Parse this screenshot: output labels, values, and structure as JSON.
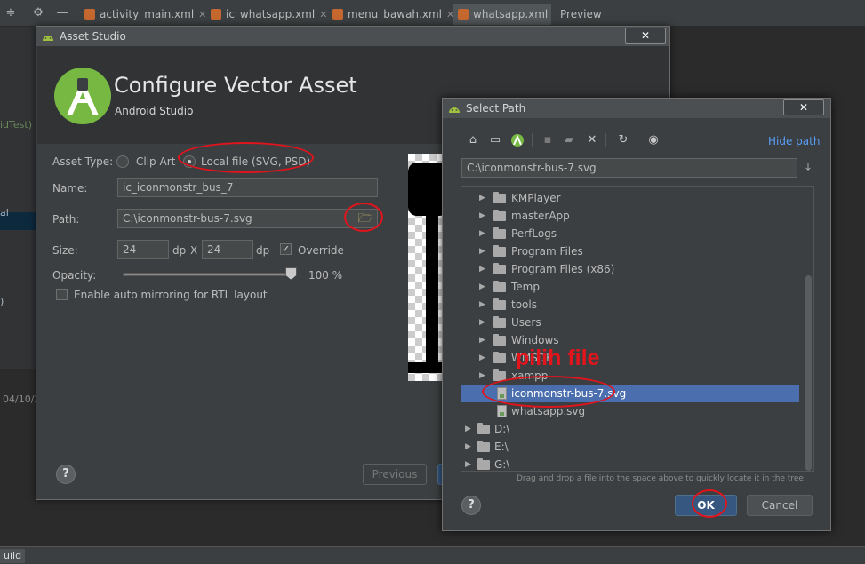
{
  "ide": {
    "tabs": [
      {
        "label": "activity_main.xml"
      },
      {
        "label": "ic_whatsapp.xml"
      },
      {
        "label": "menu_bawah.xml"
      },
      {
        "label": "whatsapp.xml"
      }
    ],
    "preview_tab": "Preview",
    "left_fragments": [
      "idTest)",
      "al",
      ")"
    ],
    "bottom_fragment": "04/10/2",
    "status_build": "uild"
  },
  "asset_studio": {
    "window_title": "Asset Studio",
    "close_glyph": "✕",
    "header_title": "Configure Vector Asset",
    "header_subtitle": "Android Studio",
    "asset_type_label": "Asset Type:",
    "asset_type_options": [
      "Clip Art",
      "Local file (SVG, PSD)"
    ],
    "asset_type_selected": "Local file (SVG, PSD)",
    "name_label": "Name:",
    "name_value": "ic_iconmonstr_bus_7",
    "path_label": "Path:",
    "path_value": "C:\\iconmonstr-bus-7.svg",
    "size_label": "Size:",
    "width_value": "24",
    "height_value": "24",
    "unit": "dp",
    "size_separator": "X",
    "override_label": "Override",
    "override_checked": true,
    "opacity_label": "Opacity:",
    "opacity_value": "100 %",
    "opacity_level": 1.0,
    "rtl_label": "Enable auto mirroring for RTL layout",
    "rtl_checked": false,
    "previous_label": "Previous",
    "help_glyph": "?"
  },
  "select_path": {
    "window_title": "Select Path",
    "close_glyph": "✕",
    "toolbar_icons": [
      "home-icon",
      "desktop-icon",
      "android-project-icon",
      "module-icon",
      "new-folder-icon",
      "delete-icon",
      "refresh-icon",
      "show-hidden-icon"
    ],
    "hide_path_label": "Hide path",
    "path_value": "C:\\iconmonstr-bus-7.svg",
    "tree_items": [
      {
        "label": "KMPlayer",
        "type": "folder"
      },
      {
        "label": "masterApp",
        "type": "folder"
      },
      {
        "label": "PerfLogs",
        "type": "folder"
      },
      {
        "label": "Program Files",
        "type": "folder"
      },
      {
        "label": "Program Files (x86)",
        "type": "folder"
      },
      {
        "label": "Temp",
        "type": "folder"
      },
      {
        "label": "tools",
        "type": "folder"
      },
      {
        "label": "Users",
        "type": "folder"
      },
      {
        "label": "Windows",
        "type": "folder"
      },
      {
        "label": "WMSDK",
        "type": "folder"
      },
      {
        "label": "xampp",
        "type": "folder"
      },
      {
        "label": "iconmonstr-bus-7.svg",
        "type": "file",
        "selected": true
      },
      {
        "label": "whatsapp.svg",
        "type": "file"
      },
      {
        "label": "D:\\",
        "type": "drive"
      },
      {
        "label": "E:\\",
        "type": "drive"
      },
      {
        "label": "G:\\",
        "type": "drive"
      }
    ],
    "drag_hint": "Drag and drop a file into the space above to quickly locate it in the tree",
    "ok_label": "OK",
    "cancel_label": "Cancel",
    "help_glyph": "?"
  },
  "annotation": {
    "text": "pilih file",
    "color": "#e4141c"
  }
}
